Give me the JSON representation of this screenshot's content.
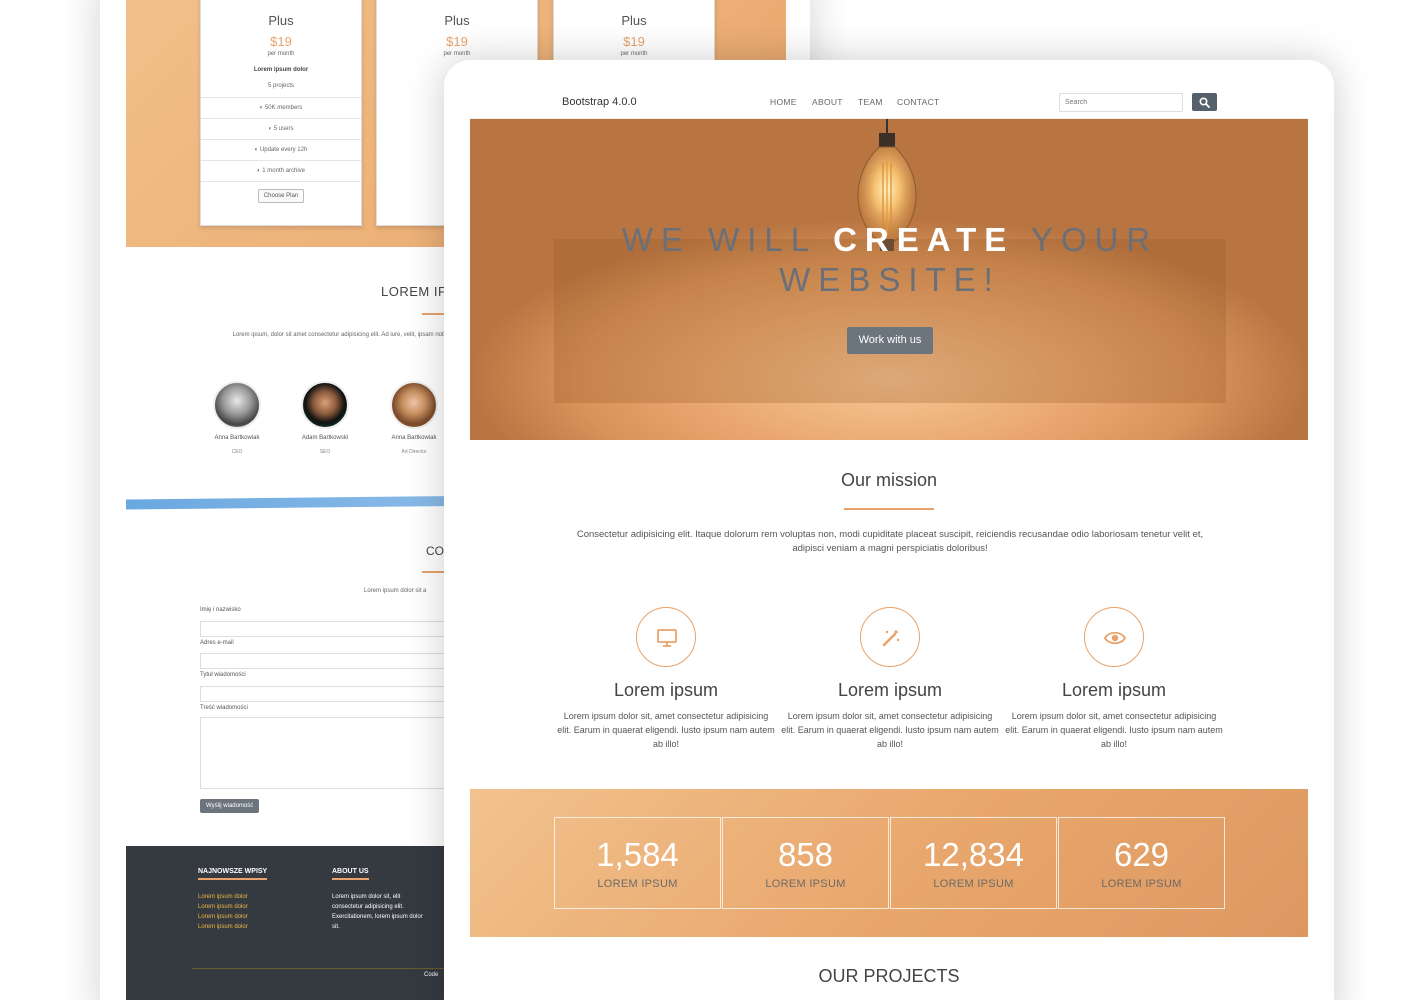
{
  "back": {
    "pricing": {
      "plans": [
        {
          "title": "Plus",
          "price": "$19",
          "per": "per month",
          "sub": "Lorem ipsum dolor",
          "projects": "5 projects",
          "features": [
            "50K members",
            "5 users",
            "Update every 12h",
            "1 month archive"
          ],
          "button": "Choose Plan"
        },
        {
          "title": "Plus",
          "price": "$19",
          "per": "per month"
        },
        {
          "title": "Plus",
          "price": "$19",
          "per": "per month"
        }
      ]
    },
    "team": {
      "title": "LOREM IP",
      "text": "Lorem ipsum, dolor sit amet consectetur adipisicing elit. Ad iure, velit, ipsam nobis sed facere",
      "members": [
        {
          "name": "Anna Bartkowiak",
          "role": "CEO"
        },
        {
          "name": "Adam Bartkowski",
          "role": "SEO"
        },
        {
          "name": "Anna Bartkowiak",
          "role": "Art Director"
        }
      ]
    },
    "contact": {
      "title": "CO",
      "text": "Lorem ipsum dolor sit a",
      "labels": [
        "Imię i nazwisko",
        "Adres e-mail",
        "Tytuł wiadomości",
        "Treść wiadomości"
      ],
      "button": "Wyślij wiadomość"
    },
    "footer": {
      "col1_title": "NAJNOWSZE WPISY",
      "links": [
        "Lorem ipsum dolor",
        "Lorem ipsum dolor",
        "Lorem ipsum dolor",
        "Lorem ipsum dolor"
      ],
      "col2_title": "ABOUT US",
      "about_text": "Lorem ipsum dolor sit, elit consectetur adipisicing elit. Exercitationem, lorem ipsum dolor sit.",
      "code": "Code"
    }
  },
  "front": {
    "brand": "Bootstrap 4.0.0",
    "nav": [
      "HOME",
      "ABOUT",
      "TEAM",
      "CONTACT"
    ],
    "search": {
      "placeholder": "Search"
    },
    "hero": {
      "pre": "WE WILL",
      "highlight": "CREATE",
      "post": "YOUR",
      "line2": "WEBSITE!",
      "button": "Work with us"
    },
    "mission": {
      "title": "Our mission",
      "text": "Consectetur adipisicing elit. Itaque dolorum rem voluptas non, modi cupiditate placeat suscipit, reiciendis recusandae odio laboriosam tenetur velit et, adipisci veniam a magni perspiciatis doloribus!"
    },
    "features": [
      {
        "icon": "monitor-icon",
        "title": "Lorem ipsum",
        "text": "Lorem ipsum dolor sit, amet consectetur adipisicing elit. Earum in quaerat eligendi. Iusto ipsum nam autem ab illo!"
      },
      {
        "icon": "magic-wand-icon",
        "title": "Lorem ipsum",
        "text": "Lorem ipsum dolor sit, amet consectetur adipisicing elit. Earum in quaerat eligendi. Iusto ipsum nam autem ab illo!"
      },
      {
        "icon": "eye-icon",
        "title": "Lorem ipsum",
        "text": "Lorem ipsum dolor sit, amet consectetur adipisicing elit. Earum in quaerat eligendi. Iusto ipsum nam autem ab illo!"
      }
    ],
    "stats": [
      {
        "value": "1,584",
        "label": "LOREM IPSUM"
      },
      {
        "value": "858",
        "label": "LOREM IPSUM"
      },
      {
        "value": "12,834",
        "label": "LOREM IPSUM"
      },
      {
        "value": "629",
        "label": "LOREM IPSUM"
      }
    ],
    "projects_title": "OUR PROJECTS"
  },
  "colors": {
    "accent": "#e8a26a",
    "button": "#6c757d",
    "footer": "#343a40",
    "footer_link": "#f0b840"
  }
}
